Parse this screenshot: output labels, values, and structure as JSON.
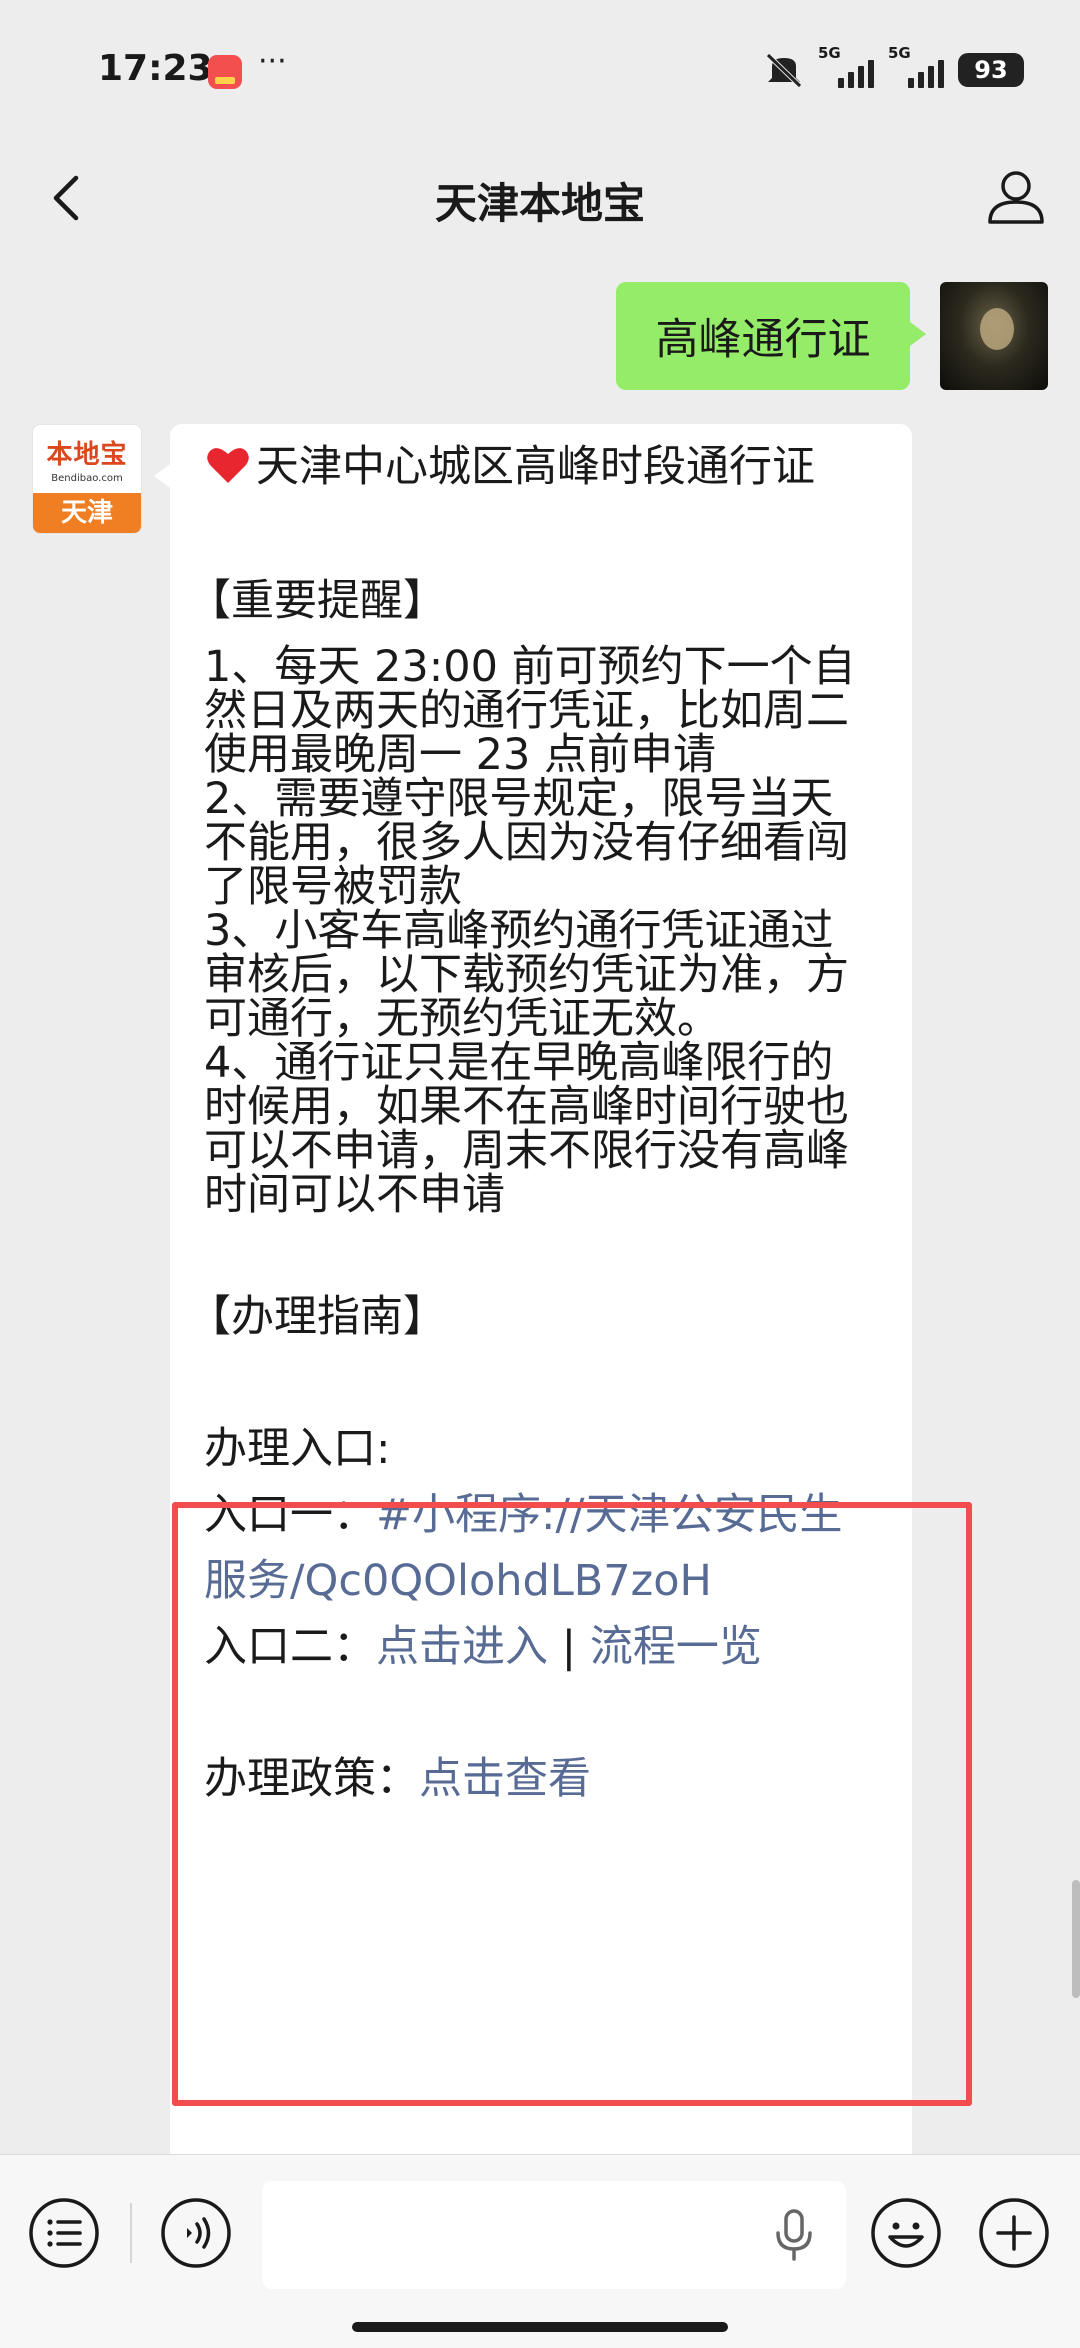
{
  "status_bar": {
    "time": "17:23",
    "more": "···",
    "network_1": "5G",
    "network_2": "5G",
    "battery": "93"
  },
  "nav": {
    "title": "天津本地宝"
  },
  "messages": {
    "outgoing": "高峰通行证",
    "bot_avatar": {
      "logo_text": "本地宝",
      "logo_sub": "Bendibao.com",
      "city": "天津"
    },
    "incoming": {
      "title": "天津中心城区高峰时段通行证",
      "reminder_heading": "【重要提醒】",
      "reminder_lines": [
        "1、每天 23:00 前可预约下一个自",
        "然日及两天的通行凭证，比如周二",
        "使用最晚周一 23 点前申请",
        "2、需要遵守限号规定，限号当天",
        "不能用，很多人因为没有仔细看闯",
        "了限号被罚款",
        "3、小客车高峰预约通行凭证通过",
        "审核后，以下载预约凭证为准，方",
        "可通行，无预约凭证无效。",
        "4、通行证只是在早晚高峰限行的",
        "时候用，如果不在高峰时间行驶也",
        "可以不申请，周末不限行没有高峰",
        "时间可以不申请"
      ],
      "guide_heading": "【办理指南】",
      "entry_heading": "办理入口:",
      "entry1_label": "入口一：",
      "entry1_link_a": "#小程序://天津公安民生",
      "entry1_link_b": "服务/Qc0QOlohdLB7zoH",
      "entry2_label": "入口二：",
      "entry2_link1": "点击进入",
      "entry2_sep": " | ",
      "entry2_link2": "流程一览",
      "policy_label": "办理政策：",
      "policy_link": "点击查看"
    }
  },
  "colors": {
    "outgoing_bubble": "#95ec69",
    "link": "#576b95",
    "highlight": "#f24c4c",
    "logo_orange": "#f07e22"
  },
  "icons": [
    "back-icon",
    "profile-icon",
    "heart-icon",
    "list-icon",
    "voice-icon",
    "mic-icon",
    "emoji-icon",
    "plus-icon"
  ]
}
